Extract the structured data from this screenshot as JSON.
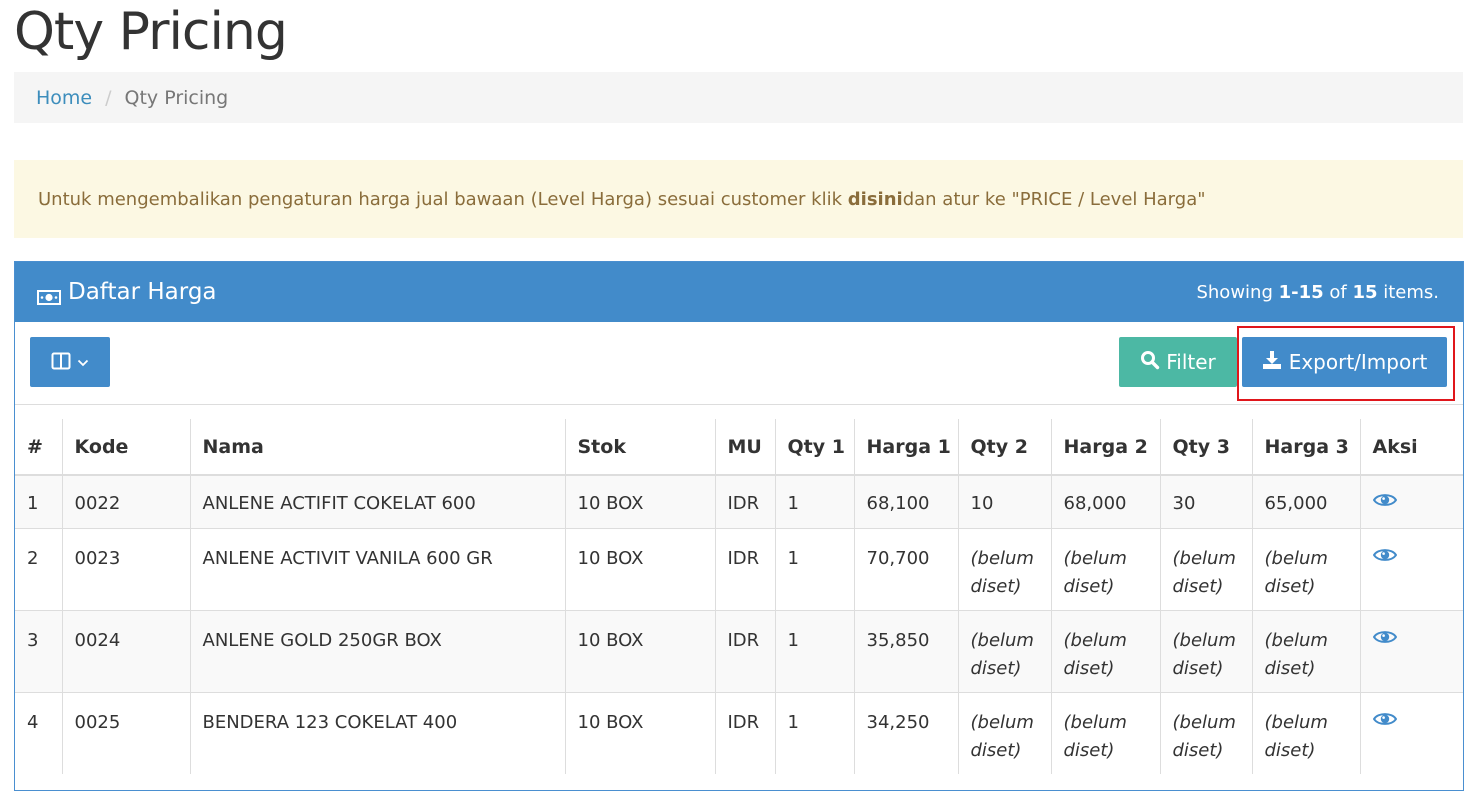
{
  "page": {
    "title": "Qty Pricing"
  },
  "breadcrumb": {
    "home": "Home",
    "separator": "/",
    "current": "Qty Pricing"
  },
  "alert": {
    "text_before": "Untuk mengembalikan pengaturan harga jual bawaan (Level Harga) sesuai customer klik ",
    "link": "disini",
    "text_after": " dan atur ke \"PRICE / Level Harga\""
  },
  "panel": {
    "title": "Daftar Harga",
    "summary_prefix": "Showing ",
    "summary_range": "1-15",
    "summary_of": " of ",
    "summary_total": "15",
    "summary_suffix": " items."
  },
  "toolbar": {
    "filter_label": "Filter",
    "export_label": "Export/Import"
  },
  "table": {
    "headers": [
      "#",
      "Kode",
      "Nama",
      "Stok",
      "MU",
      "Qty 1",
      "Harga 1",
      "Qty 2",
      "Harga 2",
      "Qty 3",
      "Harga 3",
      "Aksi"
    ],
    "unset_text": "(belum diset)",
    "rows": [
      {
        "no": "1",
        "kode": "0022",
        "nama": "ANLENE ACTIFIT COKELAT 600",
        "stok": "10 BOX",
        "mu": "IDR",
        "qty1": "1",
        "harga1": "68,100",
        "qty2": "10",
        "harga2": "68,000",
        "qty3": "30",
        "harga3": "65,000"
      },
      {
        "no": "2",
        "kode": "0023",
        "nama": "ANLENE ACTIVIT VANILA 600 GR",
        "stok": "10 BOX",
        "mu": "IDR",
        "qty1": "1",
        "harga1": "70,700",
        "qty2": "(belum diset)",
        "harga2": "(belum diset)",
        "qty3": "(belum diset)",
        "harga3": "(belum diset)"
      },
      {
        "no": "3",
        "kode": "0024",
        "nama": "ANLENE GOLD 250GR BOX",
        "stok": "10 BOX",
        "mu": "IDR",
        "qty1": "1",
        "harga1": "35,850",
        "qty2": "(belum diset)",
        "harga2": "(belum diset)",
        "qty3": "(belum diset)",
        "harga3": "(belum diset)"
      },
      {
        "no": "4",
        "kode": "0025",
        "nama": "BENDERA 123 COKELAT 400",
        "stok": "10 BOX",
        "mu": "IDR",
        "qty1": "1",
        "harga1": "34,250",
        "qty2": "(belum diset)",
        "harga2": "(belum diset)",
        "qty3": "(belum diset)",
        "harga3": "(belum diset)"
      }
    ]
  },
  "icons": {
    "panel": "money-icon",
    "columns": "columns-icon",
    "filter": "search-icon",
    "export": "download-icon",
    "view": "eye-icon"
  },
  "colors": {
    "primary": "#428bca",
    "filter": "#4cb8a4",
    "unset": "#c0565a",
    "highlight": "#e0161b",
    "alert_bg": "#fcf8e3"
  }
}
